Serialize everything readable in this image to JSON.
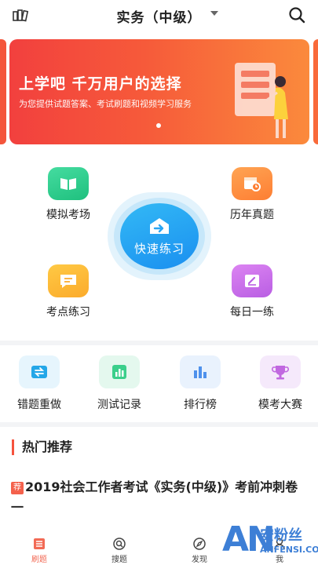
{
  "header": {
    "title": "实务（中级）",
    "left_icon": "books-icon",
    "search_icon": "search-icon"
  },
  "banner": {
    "headline": "上学吧   千万用户的选择",
    "subline": "为您提供试题答案、考试刷题和视频学习服务",
    "page_count": 1,
    "active_page": 1
  },
  "features": {
    "mock_exam": "模拟考场",
    "past_papers": "历年真题",
    "quick_practice": "快速练习",
    "point_practice": "考点练习",
    "daily_practice": "每日一练"
  },
  "tools": {
    "wrong_redo": "错题重做",
    "test_records": "测试记录",
    "ranking": "排行榜",
    "mock_contest": "模考大赛"
  },
  "hot": {
    "title": "热门推荐",
    "tag": "荐",
    "article_title": "2019社会工作者考试《实务(中级)》考前冲刺卷一"
  },
  "nav": {
    "items": [
      "刷题",
      "搜题",
      "发现",
      "我"
    ],
    "active": "刷题"
  },
  "watermark": {
    "logo_text": "AN",
    "cn_text": "安粉丝",
    "en_text": "ANFENSI.COM"
  },
  "colors": {
    "accent": "#f26a55",
    "banner_start": "#f2403e",
    "banner_end": "#fb8a3c",
    "quick_blue": "#1a8ff0",
    "mock_green": "#2fcf8c",
    "past_orange": "#fd8f3f",
    "point_yellow": "#fbb53a",
    "daily_purple": "#c86de8"
  }
}
